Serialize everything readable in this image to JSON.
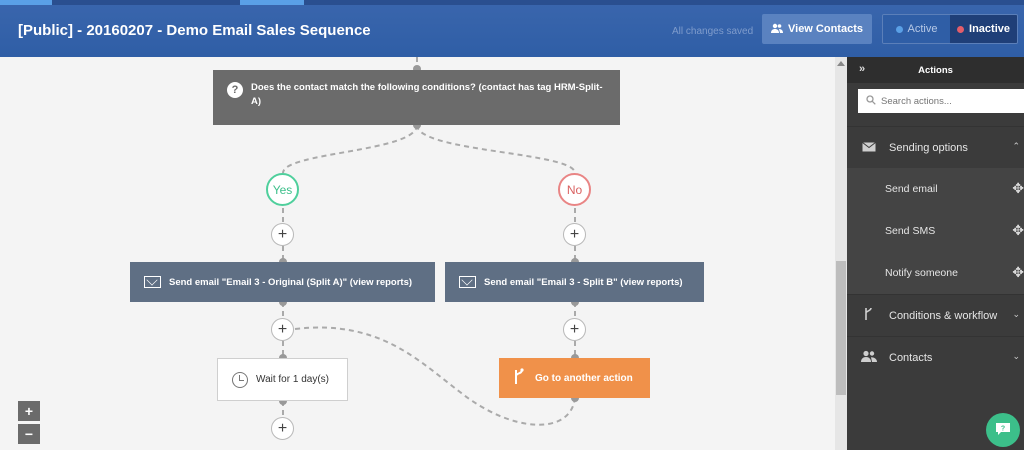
{
  "header": {
    "title": "[Public] - 20160207 - Demo Email Sales Sequence",
    "saved_text": "All changes saved",
    "view_contacts_label": "View Contacts",
    "status_active_label": "Active",
    "status_inactive_label": "Inactive",
    "colors": {
      "active_dot": "#5aa0e6",
      "inactive_dot": "#e35d6a"
    }
  },
  "flow": {
    "condition_text": "Does the contact match the following conditions? (contact has tag HRM-Split-A)",
    "branch_yes": "Yes",
    "branch_no": "No",
    "email_a": "Send email \"Email 3 - Original (Split A)\" (view reports)",
    "email_b": "Send email \"Email 3 - Split B\" (view reports)",
    "wait_text": "Wait for 1 day(s)",
    "goto_text": "Go to another action",
    "plus_symbol": "+",
    "zoom_in": "+",
    "zoom_out": "−"
  },
  "sidebar": {
    "title": "Actions",
    "collapse_icon": "»",
    "search_placeholder": "Search actions...",
    "sections": [
      {
        "label": "Sending options",
        "icon": "envelope-icon",
        "expanded": true
      },
      {
        "label": "Conditions & workflow",
        "icon": "branch-icon",
        "expanded": false
      },
      {
        "label": "Contacts",
        "icon": "users-icon",
        "expanded": false
      }
    ],
    "items": [
      {
        "label": "Send email"
      },
      {
        "label": "Send SMS"
      },
      {
        "label": "Notify someone"
      }
    ]
  }
}
